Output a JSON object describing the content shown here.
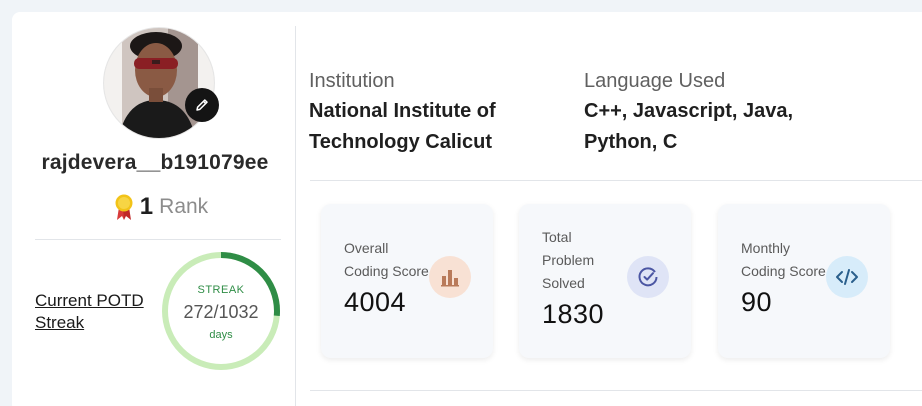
{
  "profile": {
    "username": "rajdevera__b191079ee",
    "rank_number": "1",
    "rank_label": "Rank"
  },
  "potd": {
    "link_label": "Current POTD Streak",
    "streak_label": "STREAK",
    "streak_value": "272/1032",
    "streak_unit": "days",
    "streak_fraction": 0.2636
  },
  "info": {
    "institution_label": "Institution",
    "institution_value": "National Institute of Technology Calicut",
    "language_label": "Language Used",
    "language_value": "C++, Javascript, Java, Python, C"
  },
  "stats": [
    {
      "label": "Overall Coding Score",
      "value": "4004",
      "icon": "bar-chart-icon"
    },
    {
      "label": "Total Problem Solved",
      "value": "1830",
      "icon": "check-circle-icon"
    },
    {
      "label": "Monthly Coding Score",
      "value": "90",
      "icon": "code-icon"
    }
  ],
  "colors": {
    "streak_ring_fill": "#2f8d46",
    "streak_ring_track": "#c9ecb8",
    "stat_icon1_bg": "#f8e1d4",
    "stat_icon2_bg": "#dfe4f6",
    "stat_icon3_bg": "#d7ecfa"
  }
}
